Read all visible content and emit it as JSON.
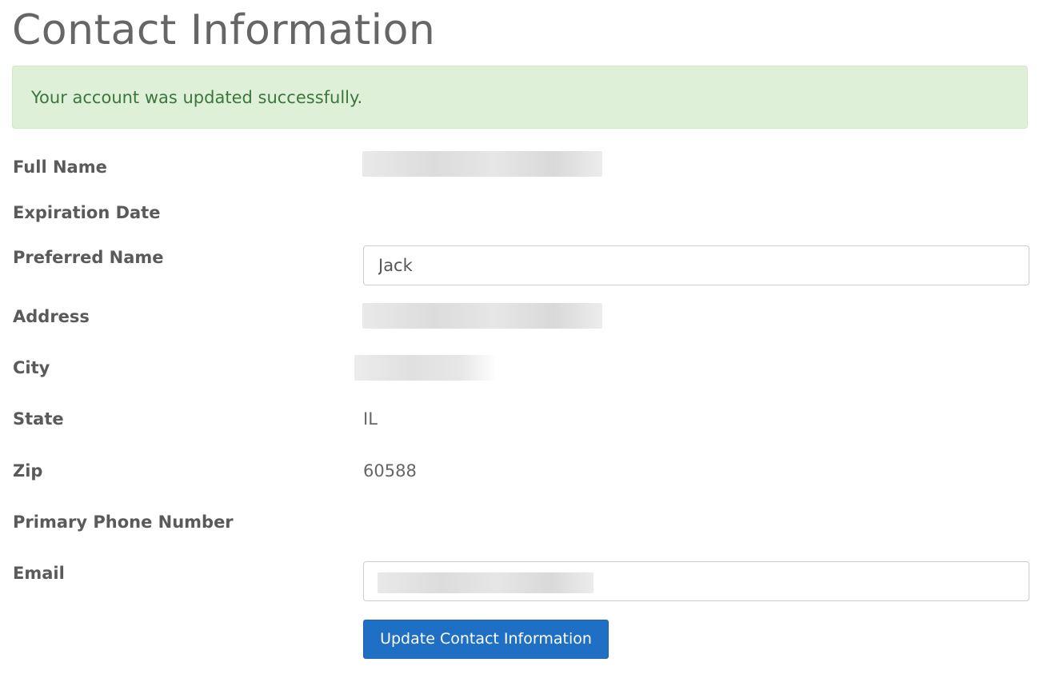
{
  "page": {
    "title": "Contact Information"
  },
  "alert": {
    "message": "Your account was updated successfully."
  },
  "fields": {
    "full_name": {
      "label": "Full Name"
    },
    "expiration_date": {
      "label": "Expiration Date"
    },
    "preferred_name": {
      "label": "Preferred Name",
      "value": "Jack"
    },
    "address": {
      "label": "Address"
    },
    "city": {
      "label": "City"
    },
    "state": {
      "label": "State",
      "value": "IL"
    },
    "zip": {
      "label": "Zip",
      "value": "60588"
    },
    "primary_phone": {
      "label": "Primary Phone Number"
    },
    "email": {
      "label": "Email"
    }
  },
  "actions": {
    "update_label": "Update Contact Information"
  },
  "colors": {
    "alert_background": "#dff0d8",
    "alert_text": "#3c763d",
    "button_background": "#1f6fc5"
  }
}
